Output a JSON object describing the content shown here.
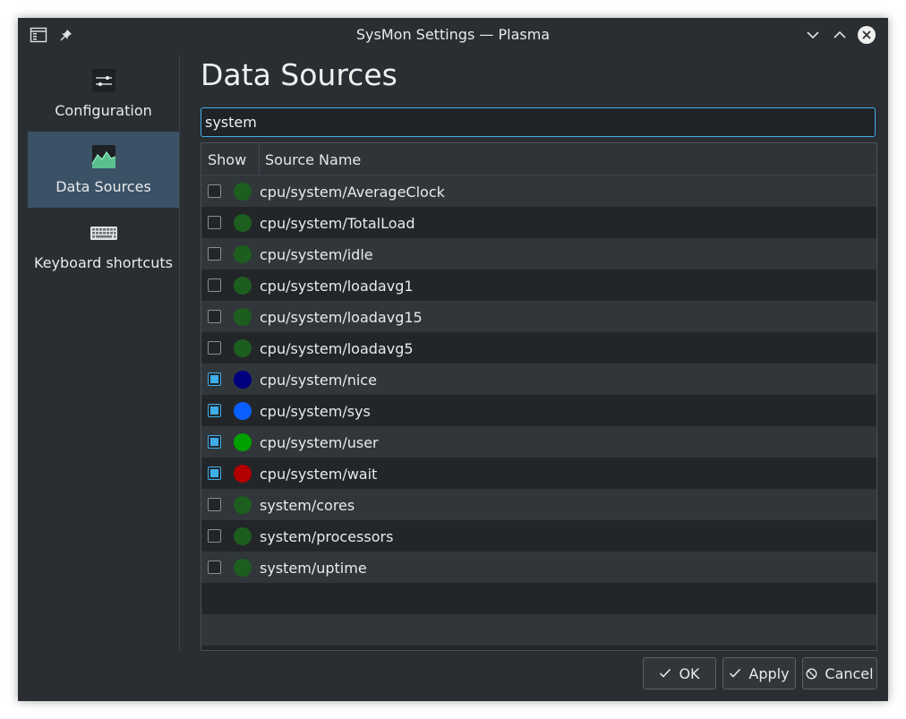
{
  "window": {
    "title": "SysMon Settings — Plasma",
    "accent": "#3daee9"
  },
  "titlebar_icons": [
    "app-menu-icon",
    "pin-icon",
    "minimize-icon",
    "maximize-icon",
    "close-icon"
  ],
  "sidebar": {
    "items": [
      {
        "label": "Configuration",
        "icon": "sliders-icon",
        "active": false
      },
      {
        "label": "Data Sources",
        "icon": "chart-icon",
        "active": true
      },
      {
        "label": "Keyboard shortcuts",
        "icon": "keyboard-icon",
        "active": false
      }
    ]
  },
  "page": {
    "title": "Data Sources",
    "search_value": "system"
  },
  "table": {
    "headers": {
      "show": "Show",
      "source": "Source Name"
    },
    "rows": [
      {
        "name": "cpu/system/AverageClock",
        "checked": false,
        "color": "#1d5e1f"
      },
      {
        "name": "cpu/system/TotalLoad",
        "checked": false,
        "color": "#1d5e1f"
      },
      {
        "name": "cpu/system/idle",
        "checked": false,
        "color": "#1d5e1f"
      },
      {
        "name": "cpu/system/loadavg1",
        "checked": false,
        "color": "#1d5e1f"
      },
      {
        "name": "cpu/system/loadavg15",
        "checked": false,
        "color": "#1d5e1f"
      },
      {
        "name": "cpu/system/loadavg5",
        "checked": false,
        "color": "#1d5e1f"
      },
      {
        "name": "cpu/system/nice",
        "checked": true,
        "color": "#00007f"
      },
      {
        "name": "cpu/system/sys",
        "checked": true,
        "color": "#0a5fff"
      },
      {
        "name": "cpu/system/user",
        "checked": true,
        "color": "#00a000"
      },
      {
        "name": "cpu/system/wait",
        "checked": true,
        "color": "#b20000"
      },
      {
        "name": "system/cores",
        "checked": false,
        "color": "#1d5e1f"
      },
      {
        "name": "system/processors",
        "checked": false,
        "color": "#1d5e1f"
      },
      {
        "name": "system/uptime",
        "checked": false,
        "color": "#1d5e1f"
      }
    ]
  },
  "buttons": {
    "ok": "OK",
    "apply": "Apply",
    "cancel": "Cancel"
  }
}
